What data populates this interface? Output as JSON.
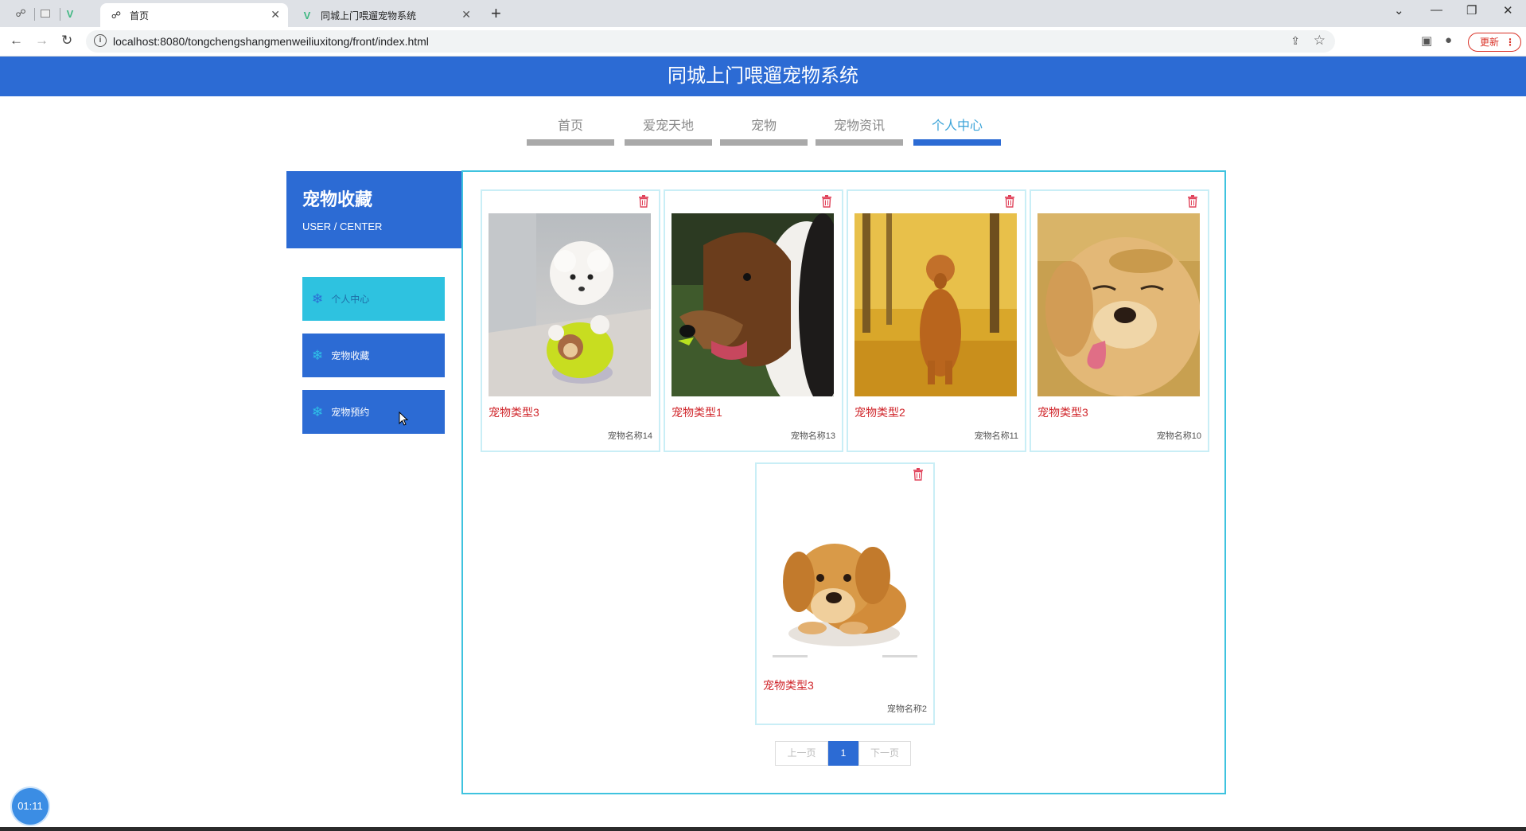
{
  "browser": {
    "tabs": [
      {
        "title": "首页",
        "active": true
      },
      {
        "title": "同城上门喂遛宠物系统",
        "active": false
      }
    ],
    "url": "localhost:8080/tongchengshangmenweiliuxitong/front/index.html",
    "update_label": "更新"
  },
  "site": {
    "title": "同城上门喂遛宠物系统"
  },
  "nav": {
    "items": [
      "首页",
      "爱宠天地",
      "宠物",
      "宠物资讯",
      "个人中心"
    ],
    "active_index": 4
  },
  "sidebar": {
    "title": "宠物收藏",
    "subtitle": "USER / CENTER",
    "items": [
      {
        "label": "个人中心"
      },
      {
        "label": "宠物收藏"
      },
      {
        "label": "宠物预约"
      }
    ]
  },
  "cards": [
    {
      "type": "宠物类型3",
      "name": "宠物名称14",
      "image": "white-poodle-photo"
    },
    {
      "type": "宠物类型1",
      "name": "宠物名称13",
      "image": "collie-photo"
    },
    {
      "type": "宠物类型2",
      "name": "宠物名称11",
      "image": "golden-retriever-autumn-photo"
    },
    {
      "type": "宠物类型3",
      "name": "宠物名称10",
      "image": "golden-retriever-closeup-photo"
    },
    {
      "type": "宠物类型3",
      "name": "宠物名称2",
      "image": "golden-puppy-photo"
    }
  ],
  "pager": {
    "prev_label": "上一页",
    "current": "1",
    "next_label": "下一页"
  },
  "timer": "01:11",
  "colors": {
    "brand_blue": "#2c6bd4",
    "accent_cyan": "#3fc3df",
    "type_red": "#d0262b"
  }
}
